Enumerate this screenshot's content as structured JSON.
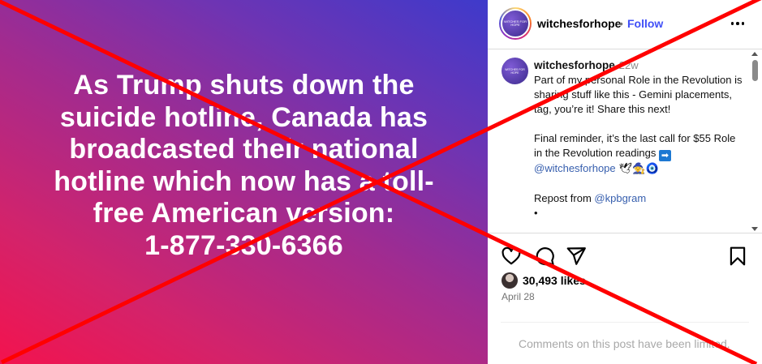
{
  "post_image": {
    "text": "As Trump shuts down the\nsuicide hotline, Canada has\nbroadcasted their national\nhotline which now has a toll-\nfree American version:\n1-877-330-6366"
  },
  "header": {
    "avatar_text": "WITCHES FOR HOPE",
    "username": "witchesforhope",
    "separator": "•",
    "follow_label": "Follow"
  },
  "caption": {
    "username": "witchesforhope",
    "time": "22w",
    "text_1": "Part of my personal Role in the Revolution is sharing stuff like this - Gemini placements, tag, you’re it! Share this next!\n\nFinal reminder, it’s the last call for $55 Role in the Revolution readings ",
    "arrow": "➡",
    "mention_1": "@witchesforhope",
    "emojis": " 🕊🧙🧿",
    "repost_prefix": "Repost from ",
    "mention_2": "@kpbgram",
    "bullet": "•"
  },
  "actions": {
    "like_icon": "heart-icon",
    "comment_icon": "comment-icon",
    "share_icon": "send-icon",
    "save_icon": "bookmark-icon"
  },
  "likes": {
    "count_text": "30,493 likes"
  },
  "date": "April 28",
  "comments_off": "Comments on this post have been limited.",
  "colors": {
    "gradient_start": "#f3134e",
    "gradient_end": "#3e3acb",
    "follow": "#4150f7",
    "mention": "#375fae",
    "cross": "#ff0000"
  }
}
